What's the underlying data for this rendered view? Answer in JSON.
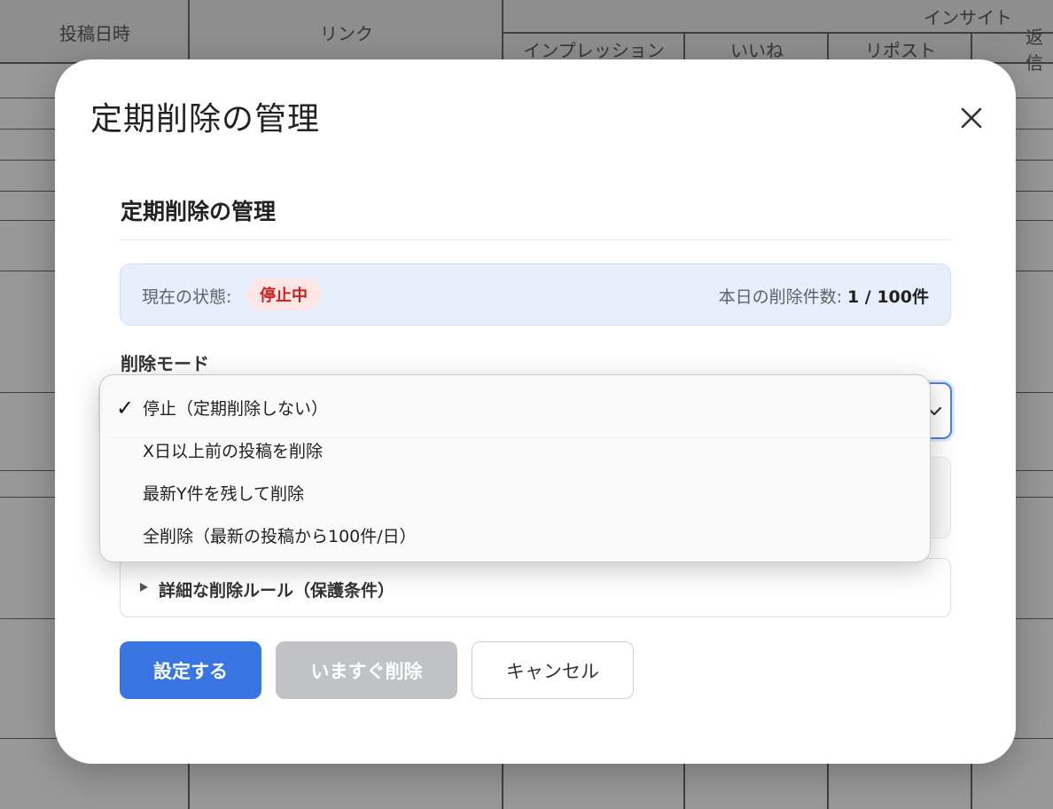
{
  "background_table": {
    "headers": {
      "posted_at": "投稿日時",
      "link": "リンク",
      "insight_group": "インサイト",
      "impressions": "インプレッション",
      "likes": "いいね",
      "reposts": "リポスト",
      "replies": "返信"
    }
  },
  "modal": {
    "title": "定期削除の管理",
    "section_title": "定期削除の管理",
    "status": {
      "label": "現在の状態:",
      "badge": "停止中",
      "count_label": "本日の削除件数:",
      "count_value": "1 / 100件"
    },
    "mode_label": "削除モード",
    "details_label": "詳細な削除ルール（保護条件）",
    "buttons": {
      "save": "設定する",
      "delete_now": "いますぐ削除",
      "cancel": "キャンセル"
    }
  },
  "dropdown": {
    "selected_index": 0,
    "options": [
      "停止（定期削除しない）",
      "X日以上前の投稿を削除",
      "最新Y件を残して削除",
      "全削除（最新の投稿から100件/日）"
    ]
  },
  "colors": {
    "primary": "#3875e2",
    "badge_text": "#c5221f",
    "badge_bg": "#fde6e3",
    "status_bg": "#e8effc"
  },
  "icons": {
    "close": "close-icon",
    "chevron": "chevron-down-icon",
    "check": "checkmark-icon",
    "disclosure": "disclosure-triangle-icon"
  }
}
